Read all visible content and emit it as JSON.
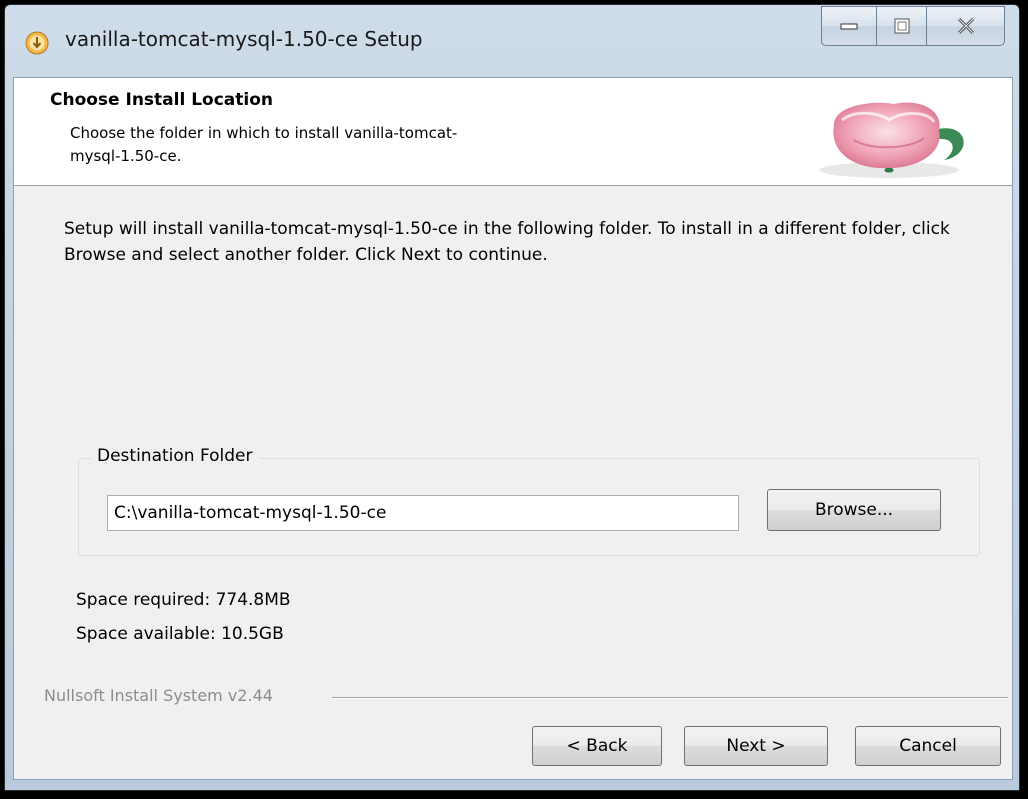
{
  "window": {
    "title": "vanilla-tomcat-mysql-1.50-ce Setup",
    "icon": "installer-icon"
  },
  "caption_buttons": {
    "minimize_icon": "minimize-icon",
    "maximize_icon": "maximize-icon",
    "close_icon": "close-icon"
  },
  "header": {
    "title": "Choose Install Location",
    "subtitle": "Choose the folder in which to install vanilla-tomcat-mysql-1.50-ce.",
    "image": "teacup-logo"
  },
  "body": {
    "intro": "Setup will install vanilla-tomcat-mysql-1.50-ce in the following folder. To install in a different folder, click Browse and select another folder. Click Next to continue."
  },
  "destination": {
    "group_label": "Destination Folder",
    "path": "C:\\vanilla-tomcat-mysql-1.50-ce",
    "browse_label": "Browse..."
  },
  "space": {
    "required": "Space required: 774.8MB",
    "available": "Space available: 10.5GB"
  },
  "footer": {
    "branding": "Nullsoft Install System v2.44",
    "back_label": "< Back",
    "next_label": "Next >",
    "cancel_label": "Cancel"
  },
  "colors": {
    "titlebar": "#c3d3e3",
    "dialog_bg": "#f0f0f0",
    "header_bg": "#ffffff",
    "branding_text": "#8c8c8c"
  }
}
